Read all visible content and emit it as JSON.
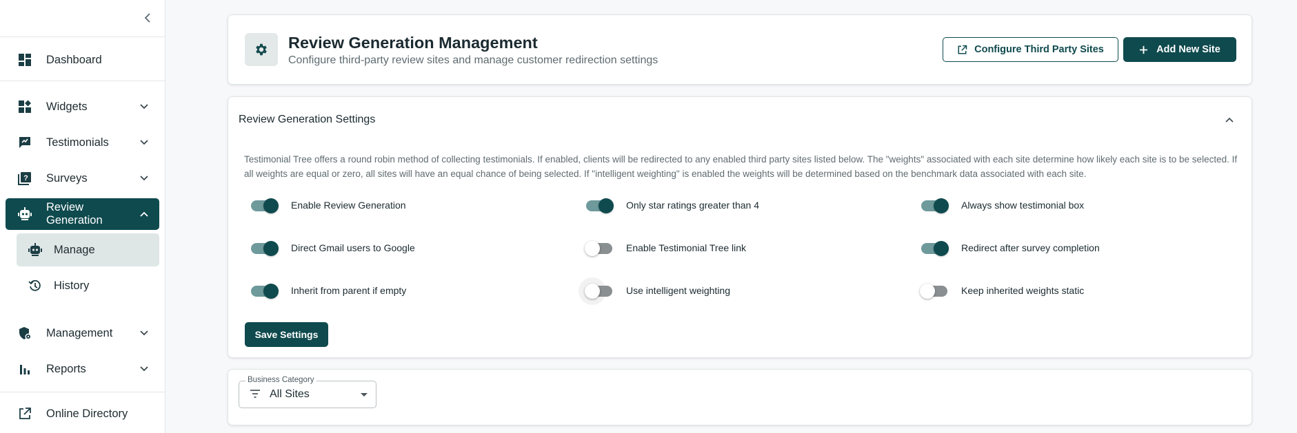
{
  "sidebar": {
    "items": [
      {
        "label": "Dashboard",
        "icon": "dashboard-icon"
      },
      {
        "label": "Widgets",
        "icon": "widgets-icon"
      },
      {
        "label": "Testimonials",
        "icon": "testimonials-icon"
      },
      {
        "label": "Surveys",
        "icon": "surveys-icon"
      },
      {
        "label": "Review Generation",
        "icon": "review-generation-icon"
      },
      {
        "label": "Manage",
        "icon": "robot-icon"
      },
      {
        "label": "History",
        "icon": "history-icon"
      },
      {
        "label": "Management",
        "icon": "management-icon"
      },
      {
        "label": "Reports",
        "icon": "reports-icon"
      },
      {
        "label": "Online Directory",
        "icon": "external-link-icon"
      }
    ]
  },
  "header": {
    "title": "Review Generation Management",
    "subtitle": "Configure third-party review sites and manage customer redirection settings",
    "configure_label": "Configure Third Party Sites",
    "add_label": "Add New Site"
  },
  "settings": {
    "title": "Review Generation Settings",
    "description": "Testimonial Tree offers a round robin method of collecting testimonials. If enabled, clients will be redirected to any enabled third party sites listed below. The \"weights\" associated with each site determine how likely each site is to be selected. If all weights are equal or zero, all sites will have an equal chance of being selected. If \"intelligent weighting\" is enabled the weights will be determined based on the benchmark data associated with each site.",
    "toggles": [
      {
        "label": "Enable Review Generation",
        "on": true
      },
      {
        "label": "Only star ratings greater than 4",
        "on": true
      },
      {
        "label": "Always show testimonial box",
        "on": true
      },
      {
        "label": "Direct Gmail users to Google",
        "on": true
      },
      {
        "label": "Enable Testimonial Tree link",
        "on": false
      },
      {
        "label": "Redirect after survey completion",
        "on": true
      },
      {
        "label": "Inherit from parent if empty",
        "on": true
      },
      {
        "label": "Use intelligent weighting",
        "on": false
      },
      {
        "label": "Keep inherited weights static",
        "on": false
      }
    ],
    "save_label": "Save Settings"
  },
  "filter": {
    "legend": "Business Category",
    "value": "All Sites"
  },
  "colors": {
    "brand": "#0f4a4e",
    "track_on": "#6e9a9c",
    "track_off": "#8a8f91"
  }
}
